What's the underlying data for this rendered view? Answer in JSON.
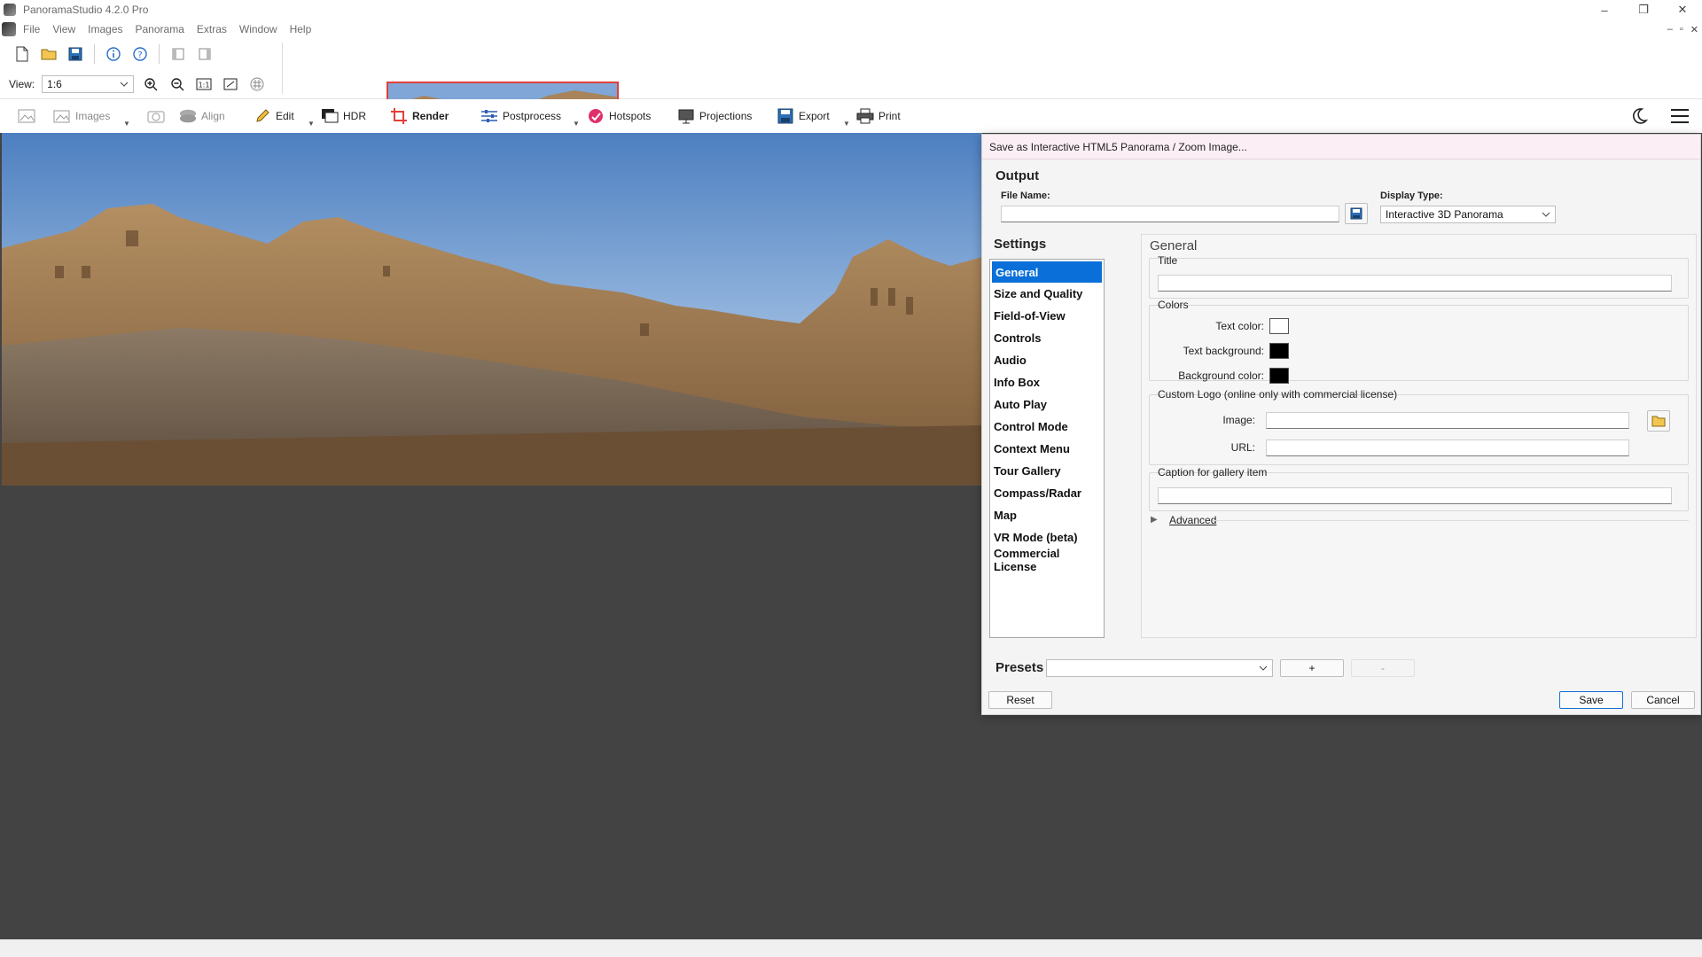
{
  "window": {
    "title": "PanoramaStudio 4.2.0 Pro",
    "controls": {
      "minimize": "–",
      "maximize": "❐",
      "close": "✕"
    }
  },
  "menubar": {
    "items": [
      "File",
      "View",
      "Images",
      "Panorama",
      "Extras",
      "Window",
      "Help"
    ],
    "mdi": {
      "minimize": "–",
      "restore": "▫",
      "close": "✕"
    }
  },
  "view": {
    "label": "View:",
    "value": "1:6"
  },
  "toolbar": {
    "images": "Images",
    "align": "Align",
    "edit": "Edit",
    "hdr": "HDR",
    "render": "Render",
    "postprocess": "Postprocess",
    "hotspots": "Hotspots",
    "projections": "Projections",
    "export": "Export",
    "print": "Print"
  },
  "dialog": {
    "title": "Save as Interactive HTML5 Panorama / Zoom Image...",
    "output_title": "Output",
    "file_name_label": "File Name:",
    "file_name_value": "",
    "display_type_label": "Display Type:",
    "display_type_value": "Interactive 3D Panorama",
    "settings_title": "Settings",
    "nav": [
      "General",
      "Size and Quality",
      "Field-of-View",
      "Controls",
      "Audio",
      "Info Box",
      "Auto Play",
      "Control Mode",
      "Context Menu",
      "Tour Gallery",
      "Compass/Radar",
      "Map",
      "VR Mode (beta)",
      "Commercial License"
    ],
    "general": {
      "heading": "General",
      "title_group": "Title",
      "title_value": "",
      "colors_group": "Colors",
      "text_color_label": "Text color:",
      "text_bg_label": "Text background:",
      "bg_color_label": "Background color:",
      "logo_group": "Custom Logo (online only with commercial license)",
      "image_label": "Image:",
      "url_label": "URL:",
      "caption_group": "Caption for gallery item",
      "advanced": "Advanced"
    },
    "colors": {
      "text": "#ffffff",
      "text_background": "#000000",
      "background": "#000000"
    },
    "presets_label": "Presets",
    "add_preset": "+",
    "remove_preset": "-",
    "reset": "Reset",
    "save": "Save",
    "cancel": "Cancel"
  }
}
